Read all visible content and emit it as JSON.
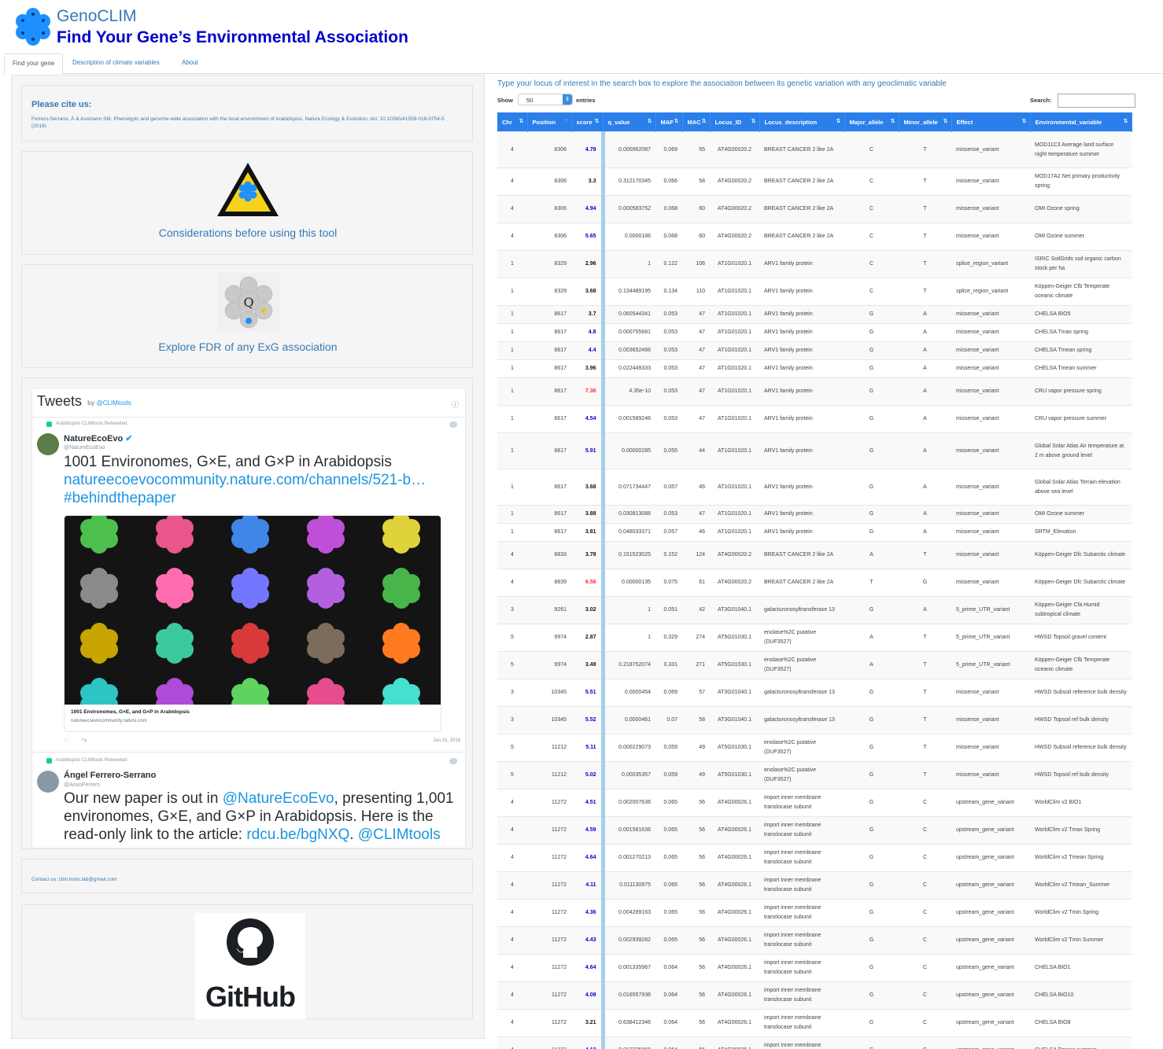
{
  "app": {
    "brand": "GenoCLIM",
    "subtitle": "Find Your Gene’s Environmental Association"
  },
  "tabs": [
    "Find your gene",
    "Description of climate variables",
    "About"
  ],
  "sidebar": {
    "cite_title": "Please cite us:",
    "cite_text": "Ferrero-Serrano, Á & Assmann SM. Phenotypic and genome-wide association with the local environment of Arabidopsis. Nature Ecology & Evolution. doi: 10.1038/s41559-018-0754-5 (2019)",
    "considerations_link": "Considerations before using this tool",
    "fdr_link": "Explore FDR of any ExG association",
    "fdr_glyph": "Q",
    "contact": "Contact us: clim.tools.lab@gmail.com",
    "github_word": "GitHub"
  },
  "tweets": {
    "header": "Tweets",
    "by_label": "by",
    "by_handle": "@CLIMtools",
    "items": [
      {
        "retweet": "Arabidopsis CLIMtools Retweeted",
        "name": "NatureEcoEvo",
        "handle": "@NatureEcoEvo",
        "text": "1001 Environomes, G×E, and G×P in Arabidopsis",
        "link": "natureecoevocommunity.nature.com/channels/521-b…",
        "hashtag": "#behindthepaper",
        "card_title": "1001 Environomes, G×E, and G×P in Arabidopsis",
        "card_domain": "natureecoevocommunity.nature.com",
        "date": "Jan 15, 2019"
      },
      {
        "retweet": "Arabidopsis CLIMtools Retweeted",
        "name": "Ángel Ferrero-Serrano",
        "handle": "@AnxoFerrero",
        "text_a": "Our new paper is out in ",
        "mention1": "@NatureEcoEvo",
        "text_b": ", presenting 1,001 environomes, G×E, and G×P in Arabidopsis. Here is the read-only link to the article: ",
        "link": "rdcu.be/bgNXQ",
        "text_c": ". ",
        "mention2": "@CLIMtools"
      }
    ]
  },
  "table_controls": {
    "instructions": "Type your locus of interest in the search box to explore the association between its genetic variation with any geoclimatic variable",
    "show_label": "Show",
    "show_value": "50",
    "entries_label": "entries",
    "search_label": "Search:"
  },
  "table": {
    "columns": [
      "Chr",
      "Position",
      "score",
      "q_value",
      "MAF",
      "MAC",
      "Locus_ID",
      "Locus_description",
      "Major_allele",
      "Minor_allele",
      "Effect",
      "Environmental_variable"
    ],
    "rows": [
      [
        "4",
        "8306",
        "4.78",
        "0.000962087",
        "0.069",
        "55",
        "AT4G00020.2",
        "BREAST CANCER 2 like 2A",
        "C",
        "T",
        "missense_variant",
        "MOD11C3 Average land surface night temperature summer"
      ],
      [
        "4",
        "8306",
        "3.3",
        "0.312170345",
        "0.066",
        "58",
        "AT4G00020.2",
        "BREAST CANCER 2 like 2A",
        "C",
        "T",
        "missense_variant",
        "MOD17A2 Net primary productivity spring"
      ],
      [
        "4",
        "8306",
        "4.94",
        "0.000583752",
        "0.068",
        "60",
        "AT4G00020.2",
        "BREAST CANCER 2 like 2A",
        "C",
        "T",
        "missense_variant",
        "OMI Ozone spring"
      ],
      [
        "4",
        "8306",
        "5.65",
        "0.0000186",
        "0.068",
        "60",
        "AT4G00020.2",
        "BREAST CANCER 2 like 2A",
        "C",
        "T",
        "missense_variant",
        "OMI Ozone summer"
      ],
      [
        "1",
        "8329",
        "2.96",
        "1",
        "0.122",
        "106",
        "AT1G01020.1",
        "ARV1 family protein",
        "C",
        "T",
        "splice_region_variant",
        "ISRIC SoilGrids soil organic carbon stock per ha"
      ],
      [
        "1",
        "8329",
        "3.68",
        "0.134489195",
        "0.134",
        "110",
        "AT1G01020.1",
        "ARV1 family protein",
        "C",
        "T",
        "splice_region_variant",
        "Köppen-Geiger Cfb Temperate oceanic climate"
      ],
      [
        "1",
        "8617",
        "3.7",
        "0.060544341",
        "0.053",
        "47",
        "AT1G01020.1",
        "ARV1 family protein",
        "G",
        "A",
        "missense_variant",
        "CHELSA BIO5"
      ],
      [
        "1",
        "8617",
        "4.8",
        "0.000755681",
        "0.053",
        "47",
        "AT1G01020.1",
        "ARV1 family protein",
        "G",
        "A",
        "missense_variant",
        "CHELSA Tmax spring"
      ],
      [
        "1",
        "8617",
        "4.4",
        "0.003652466",
        "0.053",
        "47",
        "AT1G01020.1",
        "ARV1 family protein",
        "G",
        "A",
        "missense_variant",
        "CHELSA Tmean spring"
      ],
      [
        "1",
        "8617",
        "3.96",
        "0.022449333",
        "0.053",
        "47",
        "AT1G01020.1",
        "ARV1 family protein",
        "G",
        "A",
        "missense_variant",
        "CHELSA Tmean summer"
      ],
      [
        "1",
        "8617",
        "7.36",
        "4.35e-10",
        "0.053",
        "47",
        "AT1G01020.1",
        "ARV1 family protein",
        "G",
        "A",
        "missense_variant",
        "CRU vapor pressure spring"
      ],
      [
        "1",
        "8617",
        "4.54",
        "0.001589246",
        "0.053",
        "47",
        "AT1G01020.1",
        "ARV1 family protein",
        "G",
        "A",
        "missense_variant",
        "CRU vapor pressure summer"
      ],
      [
        "1",
        "8617",
        "5.91",
        "0.00000285",
        "0.055",
        "44",
        "AT1G01020.1",
        "ARV1 family protein",
        "G",
        "A",
        "missense_variant",
        "Global Solar Atlas Air temperature at 2 m above ground level"
      ],
      [
        "1",
        "8617",
        "3.68",
        "0.071734447",
        "0.057",
        "46",
        "AT1G01020.1",
        "ARV1 family protein",
        "G",
        "A",
        "missense_variant",
        "Global Solar Atlas Terrain elevation above sea level"
      ],
      [
        "1",
        "8617",
        "3.88",
        "0.030813088",
        "0.053",
        "47",
        "AT1G01020.1",
        "ARV1 family protein",
        "G",
        "A",
        "missense_variant",
        "OMI Ozone summer"
      ],
      [
        "1",
        "8617",
        "3.81",
        "0.048033371",
        "0.057",
        "46",
        "AT1G01020.1",
        "ARV1 family protein",
        "G",
        "A",
        "missense_variant",
        "SRTM_Elevation"
      ],
      [
        "4",
        "8833",
        "3.78",
        "0.151523025",
        "0.152",
        "124",
        "AT4G00020.2",
        "BREAST CANCER 2 like 2A",
        "A",
        "T",
        "missense_variant",
        "Köppen-Geiger Dfc Subarctic climate"
      ],
      [
        "4",
        "8839",
        "6.56",
        "0.00000135",
        "0.075",
        "61",
        "AT4G00020.2",
        "BREAST CANCER 2 like 2A",
        "T",
        "G",
        "missense_variant",
        "Köppen-Geiger Dfc Subarctic climate"
      ],
      [
        "3",
        "9261",
        "3.02",
        "1",
        "0.051",
        "42",
        "AT3G01040.1",
        "galacturonosyltransferase 13",
        "G",
        "A",
        "5_prime_UTR_variant",
        "Köppen-Geiger Cfa Humid subtropical climate"
      ],
      [
        "5",
        "9974",
        "2.87",
        "1",
        "0.329",
        "274",
        "AT5G01030.1",
        "enolase%2C putative (DUF3527)",
        "A",
        "T",
        "5_prime_UTR_variant",
        "HWSD Topsoil gravel content"
      ],
      [
        "5",
        "9974",
        "3.49",
        "0.218752074",
        "0.331",
        "271",
        "AT5G01030.1",
        "enolase%2C putative (DUF3527)",
        "A",
        "T",
        "5_prime_UTR_variant",
        "Köppen-Geiger Cfb Temperate oceanic climate"
      ],
      [
        "3",
        "10345",
        "5.51",
        "0.0000454",
        "0.069",
        "57",
        "AT3G01040.1",
        "galacturonosyltransferase 13",
        "G",
        "T",
        "missense_variant",
        "HWSD Subsoil reference bulk density"
      ],
      [
        "3",
        "10345",
        "5.52",
        "0.0000461",
        "0.07",
        "58",
        "AT3G01040.1",
        "galacturonosyltransferase 13",
        "G",
        "T",
        "missense_variant",
        "HWSD Topsoil ref bulk density"
      ],
      [
        "5",
        "11212",
        "5.11",
        "0.000229073",
        "0.059",
        "49",
        "AT5G01030.1",
        "enolase%2C putative (DUF3527)",
        "G",
        "T",
        "missense_variant",
        "HWSD Subsoil reference bulk density"
      ],
      [
        "5",
        "11212",
        "5.02",
        "0.00035357",
        "0.059",
        "49",
        "AT5G01030.1",
        "enolase%2C putative (DUF3527)",
        "G",
        "T",
        "missense_variant",
        "HWSD Topsoil ref bulk density"
      ],
      [
        "4",
        "11272",
        "4.51",
        "0.002007636",
        "0.065",
        "56",
        "AT4G00026.1",
        "import inner membrane translocase subunit",
        "G",
        "C",
        "upstream_gene_variant",
        "WorldClim v2 BIO1"
      ],
      [
        "4",
        "11272",
        "4.59",
        "0.001581636",
        "0.065",
        "56",
        "AT4G00026.1",
        "import inner membrane translocase subunit",
        "G",
        "C",
        "upstream_gene_variant",
        "WorldClim v2 Tmax Spring"
      ],
      [
        "4",
        "11272",
        "4.64",
        "0.001270213",
        "0.065",
        "56",
        "AT4G00026.1",
        "import inner membrane translocase subunit",
        "G",
        "C",
        "upstream_gene_variant",
        "WorldClim v2 Tmean Spring"
      ],
      [
        "4",
        "11272",
        "4.11",
        "0.011130975",
        "0.065",
        "56",
        "AT4G00026.1",
        "import inner membrane translocase subunit",
        "G",
        "C",
        "upstream_gene_variant",
        "WorldClim v2 Tmean_Summer"
      ],
      [
        "4",
        "11272",
        "4.36",
        "0.004289163",
        "0.065",
        "56",
        "AT4G00026.1",
        "import inner membrane translocase subunit",
        "G",
        "C",
        "upstream_gene_variant",
        "WorldClim v2 Tmin Spring"
      ],
      [
        "4",
        "11272",
        "4.43",
        "0.002939282",
        "0.065",
        "56",
        "AT4G00026.1",
        "import inner membrane translocase subunit",
        "G",
        "C",
        "upstream_gene_variant",
        "WorldClim v2 Tmin Summer"
      ],
      [
        "4",
        "11272",
        "4.64",
        "0.001335967",
        "0.064",
        "56",
        "AT4G00026.1",
        "import inner membrane translocase subunit",
        "G",
        "C",
        "upstream_gene_variant",
        "CHELSA BIO1"
      ],
      [
        "4",
        "11272",
        "4.08",
        "0.016557936",
        "0.064",
        "56",
        "AT4G00026.1",
        "import inner membrane translocase subunit",
        "G",
        "C",
        "upstream_gene_variant",
        "CHELSA BIO10"
      ],
      [
        "4",
        "11272",
        "3.21",
        "0.638412346",
        "0.064",
        "56",
        "AT4G00026.1",
        "import inner membrane translocase subunit",
        "G",
        "C",
        "upstream_gene_variant",
        "CHELSA BIO8"
      ],
      [
        "4",
        "11272",
        "4.12",
        "0.013235868",
        "0.064",
        "56",
        "AT4G00026.1",
        "import inner membrane translocase subunit",
        "G",
        "C",
        "upstream_gene_variant",
        "CHELSA Tmean summer"
      ]
    ]
  },
  "colors": {
    "accent": "#337ab7",
    "header_bg": "#2a7fea",
    "score_blue": "#0000cc",
    "score_red": "#ff2a2a",
    "bar": "#a7cfea"
  }
}
